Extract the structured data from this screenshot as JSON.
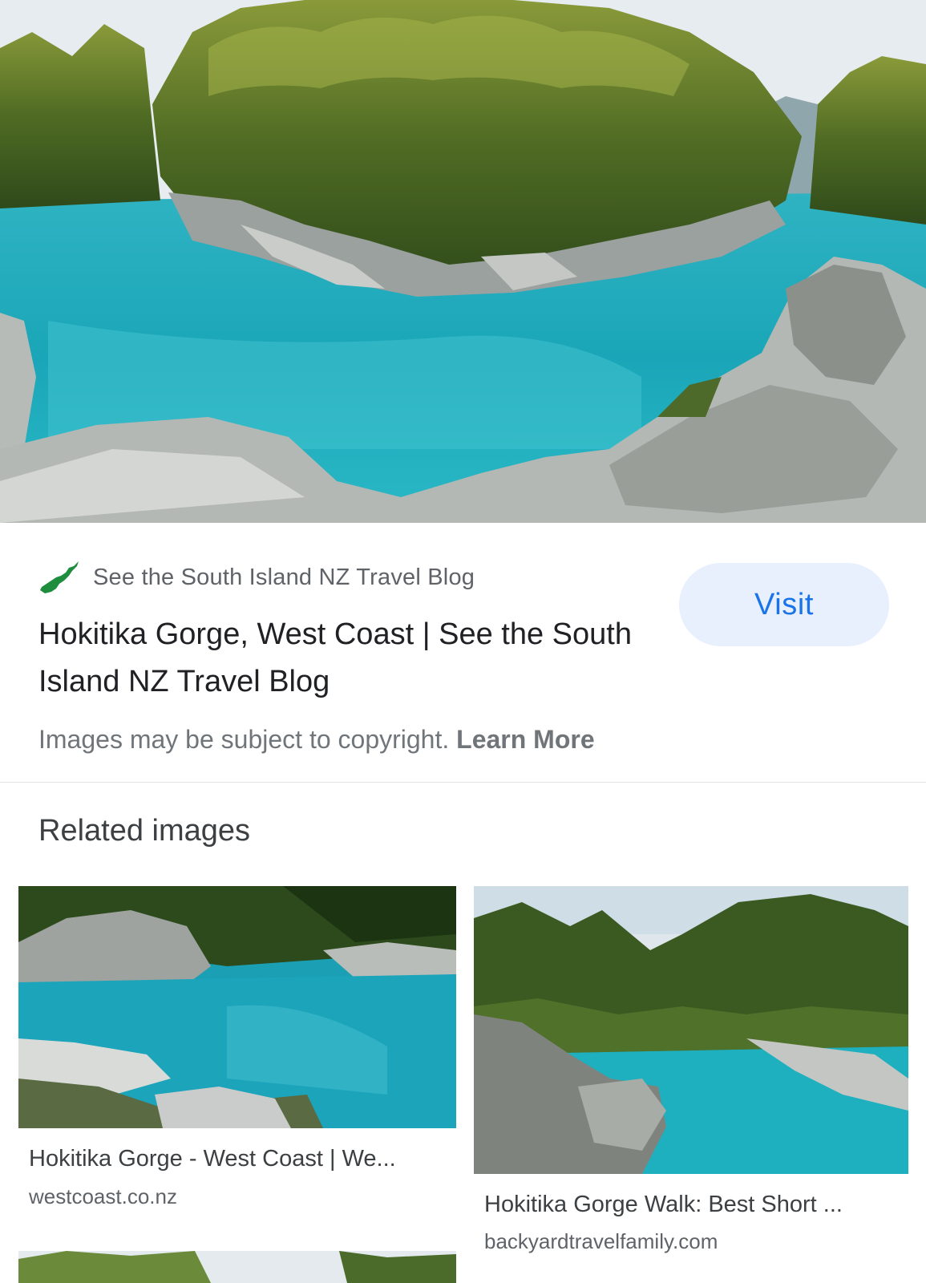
{
  "hero": {
    "image_icon": "landscape-photo"
  },
  "source": {
    "favicon_icon": "south-island-map-icon",
    "favicon_color": "#1e8e3e",
    "name": "See the South Island NZ Travel Blog"
  },
  "visit_button": {
    "label": "Visit",
    "bg_color": "#e8f0fe",
    "text_color": "#1a73e8"
  },
  "result": {
    "title": "Hokitika Gorge, West Coast | See the South Island NZ Travel Blog"
  },
  "copyright": {
    "text": "Images may be subject to copyright.",
    "link_label": "Learn More"
  },
  "related": {
    "heading": "Related images",
    "items": [
      {
        "title": "Hokitika Gorge - West Coast | We...",
        "domain": "westcoast.co.nz"
      },
      {
        "title": "Hokitika Gorge Walk: Best Short ...",
        "domain": "backyardtravelfamily.com"
      },
      {
        "title": "",
        "domain": ""
      }
    ]
  }
}
